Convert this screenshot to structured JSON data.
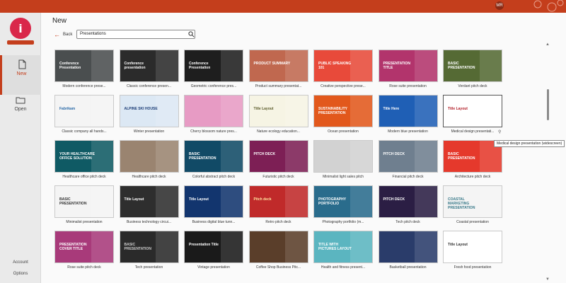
{
  "app": {
    "brand_color": "#c43e1c",
    "logo_icon": "brand-logo-icon",
    "user_initials": "MR"
  },
  "rail": {
    "new_label": "New",
    "open_label": "Open",
    "account_label": "Account",
    "options_label": "Options"
  },
  "header": {
    "title": "New",
    "back_label": "Back",
    "search_value": "Presentations"
  },
  "templates": [
    {
      "caption": "Modern conference prese...",
      "bg": "#4a4e4f",
      "fg": "#ffffff",
      "text": "Conference Presentation"
    },
    {
      "caption": "Classic conference presen...",
      "bg": "#2b2b2b",
      "fg": "#ffffff",
      "text": "Conference presentation"
    },
    {
      "caption": "Geometric conference pres...",
      "bg": "#1e1e1e",
      "fg": "#ffffff",
      "text": "Conference Presentation"
    },
    {
      "caption": "Product summary presentat...",
      "bg": "#c0684f",
      "fg": "#ffffff",
      "text": "PRODUCT SUMMARY"
    },
    {
      "caption": "Creative perspective prese...",
      "bg": "#e84a3a",
      "fg": "#ffffff",
      "text": "PUBLIC SPEAKING 101"
    },
    {
      "caption": "Rose suite presentation",
      "bg": "#b2346c",
      "fg": "#ffffff",
      "text": "PRESENTATION TITLE"
    },
    {
      "caption": "Verdant pitch deck",
      "bg": "#556a34",
      "fg": "#ffffff",
      "text": "BASIC PRESENTATION"
    },
    {
      "caption": "Classic company all hands...",
      "bg": "#f4f4f4",
      "fg": "#2a6aa8",
      "text": "Fabrikam"
    },
    {
      "caption": "Winter presentation",
      "bg": "#dce8f4",
      "fg": "#1d3e78",
      "text": "ALPINE SKI HOUSE"
    },
    {
      "caption": "Cherry blossom nature pres...",
      "bg": "#e79bc4",
      "fg": "#5a1a3a",
      "text": ""
    },
    {
      "caption": "Nature ecology education...",
      "bg": "#f6f4e4",
      "fg": "#5b5b2a",
      "text": "Title Layout"
    },
    {
      "caption": "Ocean presentation",
      "bg": "#e2581c",
      "fg": "#ffffff",
      "text": "SUSTAINABILITY PRESENTATION"
    },
    {
      "caption": "Modern blue presentation",
      "bg": "#1f5fb5",
      "fg": "#ffffff",
      "text": "Title Here"
    },
    {
      "caption": "Medical design presentati...",
      "bg": "#ffffff",
      "fg": "#b3202a",
      "text": "Title Layout"
    },
    {
      "caption": "Healthcare office pitch deck",
      "bg": "#0f5a64",
      "fg": "#ffffff",
      "text": "YOUR HEALTHCARE OFFICE SOLUTION"
    },
    {
      "caption": "Healthcare pitch deck",
      "bg": "#9a8470",
      "fg": "#ffffff",
      "text": ""
    },
    {
      "caption": "Colorful abstract pitch deck",
      "bg": "#114a66",
      "fg": "#ffffff",
      "text": "BASIC PRESENTATION"
    },
    {
      "caption": "Futuristic pitch deck",
      "bg": "#7d1f55",
      "fg": "#ffffff",
      "text": "PITCH DECK"
    },
    {
      "caption": "Minimalist light sales pitch",
      "bg": "#d2d2d2",
      "fg": "#333333",
      "text": ""
    },
    {
      "caption": "Financial pitch deck",
      "bg": "#6f7f8f",
      "fg": "#ffffff",
      "text": "PITCH DECK"
    },
    {
      "caption": "Architecture pitch deck",
      "bg": "#e5392c",
      "fg": "#ffffff",
      "text": "BASIC PRESENTATION"
    },
    {
      "caption": "Minimalist presentation",
      "bg": "#f4f4f4",
      "fg": "#333333",
      "text": "BASIC PRESENTATION"
    },
    {
      "caption": "Business technology circui...",
      "bg": "#2e2e2e",
      "fg": "#ffffff",
      "text": "Title Layout"
    },
    {
      "caption": "Business digital blue tunn...",
      "bg": "#12356e",
      "fg": "#ffffff",
      "text": "Title Layout"
    },
    {
      "caption": "Retro pitch deck",
      "bg": "#c02a2a",
      "fg": "#ffe6a0",
      "text": "Pitch deck"
    },
    {
      "caption": "Photography portfolio (m...",
      "bg": "#2a6c8c",
      "fg": "#ffffff",
      "text": "PHOTOGRAPHY PORTFOLIO"
    },
    {
      "caption": "Tech pitch deck",
      "bg": "#2b1e44",
      "fg": "#ffffff",
      "text": "PITCH DECK"
    },
    {
      "caption": "Coastal presentation",
      "bg": "#f4f4f4",
      "fg": "#3a7a8a",
      "text": "COASTAL MARKETING PRESENTATION"
    },
    {
      "caption": "Rose suite pitch deck",
      "bg": "#a83a7a",
      "fg": "#ffffff",
      "text": "PRESENTATION COVER TITLE"
    },
    {
      "caption": "Tech presentation",
      "bg": "#2a2a2a",
      "fg": "#cccccc",
      "text": "BASIC PRESENTATION"
    },
    {
      "caption": "Vintage presentation",
      "bg": "#1a1a1a",
      "fg": "#ffffff",
      "text": "Presentation Title"
    },
    {
      "caption": "Coffee Shop Business Pitc...",
      "bg": "#5a3e2a",
      "fg": "#ffffff",
      "text": ""
    },
    {
      "caption": "Health and fitness present...",
      "bg": "#5bb5c0",
      "fg": "#ffffff",
      "text": "TITLE WITH PICTURES LAYOUT"
    },
    {
      "caption": "Basketball presentation",
      "bg": "#2a3c6a",
      "fg": "#ffffff",
      "text": ""
    },
    {
      "caption": "Fresh food presentation",
      "bg": "#ffffff",
      "fg": "#333333",
      "text": "Title Layout"
    }
  ],
  "tooltip": {
    "text": "Medical design presentation (widescreen)"
  }
}
